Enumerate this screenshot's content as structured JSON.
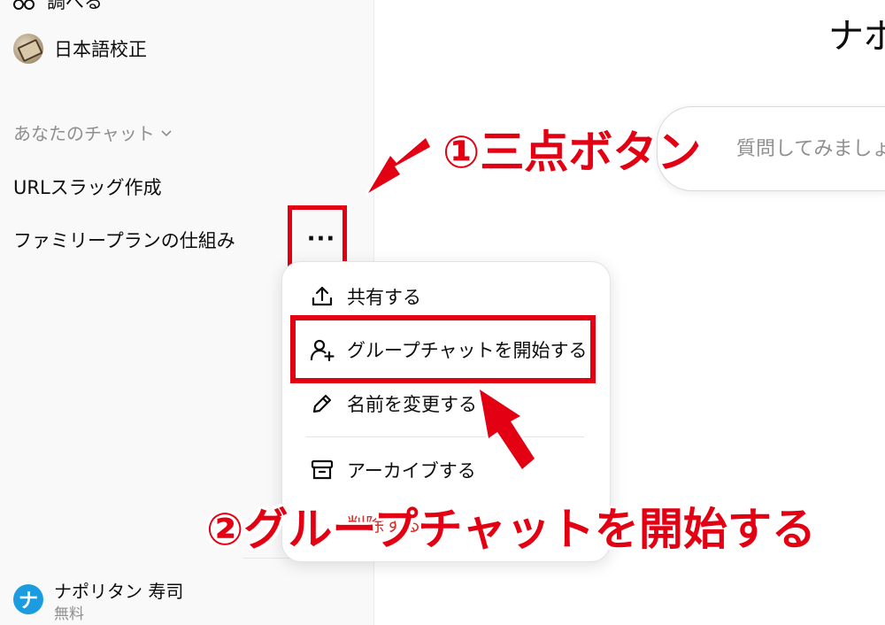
{
  "sidebar": {
    "top_cut_item": "調べる",
    "gpt_item": "日本語校正",
    "section_label": "あなたのチャット",
    "chats": [
      "URLスラッグ作成",
      "ファミリープランの仕組み"
    ],
    "more_button": "···",
    "user": {
      "avatar_letter": "ナ",
      "name": "ナポリタン 寿司",
      "plan": "無料"
    }
  },
  "main": {
    "title": "ナポ",
    "composer_placeholder": "質問してみましょう"
  },
  "context_menu": {
    "items": [
      {
        "icon": "share-icon",
        "label": "共有する"
      },
      {
        "icon": "add-person-icon",
        "label": "グループチャットを開始する"
      },
      {
        "icon": "pencil-icon",
        "label": "名前を変更する"
      },
      {
        "icon": "archive-icon",
        "label": "アーカイブする"
      },
      {
        "label": "削除する"
      }
    ]
  },
  "annotations": {
    "step1": "①三点ボタン",
    "step2": "②グループチャットを開始する",
    "color": "#e20012"
  }
}
